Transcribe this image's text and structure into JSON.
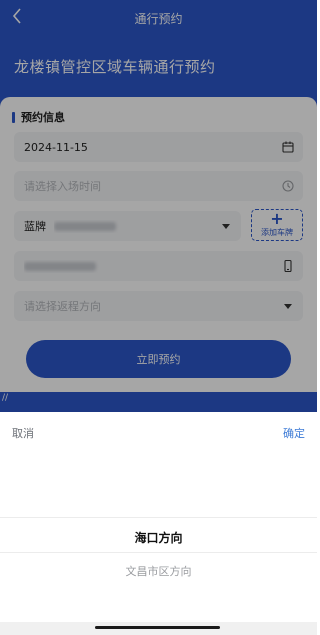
{
  "nav": {
    "title": "通行预约"
  },
  "hero": {
    "title": "龙楼镇管控区域车辆通行预约"
  },
  "form": {
    "section_title": "预约信息",
    "date_value": "2024-11-15",
    "entry_time_placeholder": "请选择入场时间",
    "plate_color": "蓝牌",
    "add_plate_label": "添加车牌",
    "return_direction_placeholder": "请选择返程方向",
    "submit_label": "立即预约",
    "strip_mark": "//"
  },
  "picker": {
    "cancel_label": "取消",
    "confirm_label": "确定",
    "options": [
      "海口方向",
      "文昌市区方向"
    ]
  },
  "colors": {
    "primary": "#2b56c9",
    "confirm": "#3d7bd6",
    "field_bg": "#f3f4f6"
  }
}
